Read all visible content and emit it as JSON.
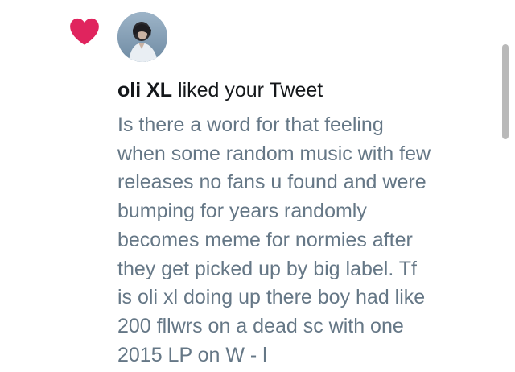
{
  "notification": {
    "user_name": "oli XL",
    "action_text": " liked your Tweet",
    "tweet_lines": [
      "Is there a word for that feeling",
      "when some random music with few",
      "releases no fans u found and were",
      "bumping for years randomly",
      "becomes meme for normies after",
      "they get picked up by big label. Tf",
      "is oli xl doing up there boy had like",
      "200 fllwrs on a dead sc with one",
      "2015 LP on W - l"
    ]
  },
  "colors": {
    "heart": "#e0245e",
    "name_text": "#14171a",
    "tweet_text": "#657786",
    "scrollbar": "#b9b9b9"
  },
  "icons": {
    "heart": "heart-icon",
    "avatar": "user-avatar"
  }
}
